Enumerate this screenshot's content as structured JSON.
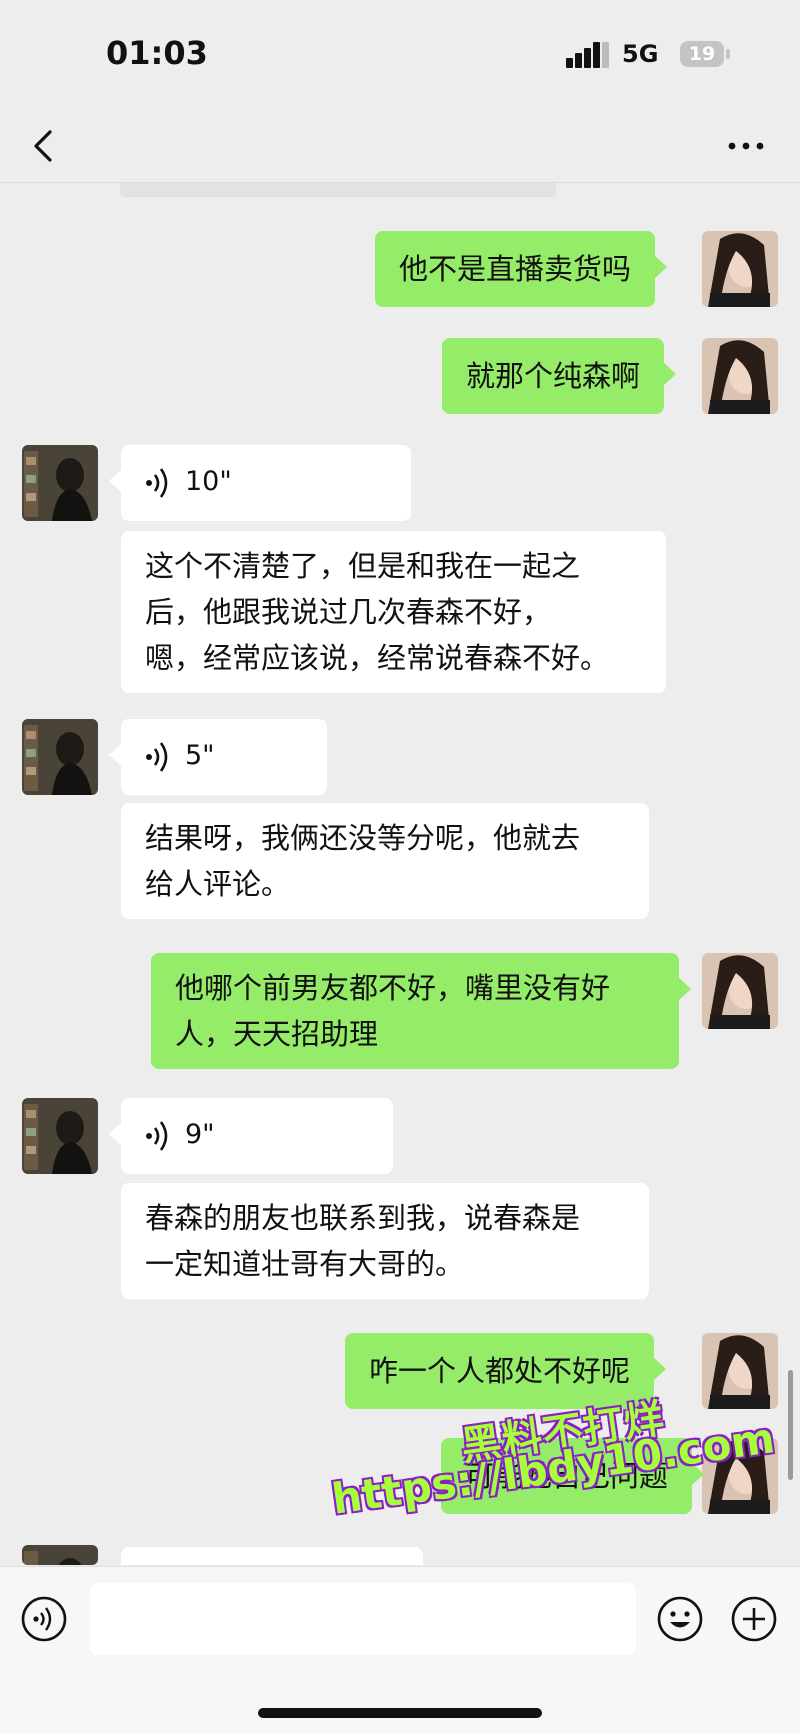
{
  "status_bar": {
    "time": "01:03",
    "network": "5G",
    "battery": "19"
  },
  "nav": {
    "back_icon": "chevron-left-icon",
    "more_icon": "more-dots-icon"
  },
  "messages": [
    {
      "side": "out",
      "type": "text",
      "text": "他不是直播卖货吗"
    },
    {
      "side": "out",
      "type": "text",
      "text": "就那个纯森啊"
    },
    {
      "side": "in",
      "type": "voice",
      "duration": "10\""
    },
    {
      "side": "in",
      "type": "text",
      "lines": [
        "这个不清楚了，但是和我在一起之",
        "后，他跟我说过几次春森不好，",
        "嗯，经常应该说，经常说春森不好。"
      ]
    },
    {
      "side": "in",
      "type": "voice",
      "duration": "5\""
    },
    {
      "side": "in",
      "type": "text",
      "lines": [
        "结果呀，我俩还没等分呢，他就去",
        "给人评论。"
      ]
    },
    {
      "side": "out",
      "type": "text",
      "lines": [
        "他哪个前男友都不好，嘴里没有好",
        "人，天天招助理"
      ]
    },
    {
      "side": "in",
      "type": "voice",
      "duration": "9\""
    },
    {
      "side": "in",
      "type": "text",
      "lines": [
        "春森的朋友也联系到我，说春森是",
        "一定知道壮哥有大哥的。"
      ]
    },
    {
      "side": "out",
      "type": "text",
      "text": "咋一个人都处不好呢"
    },
    {
      "side": "out",
      "type": "text",
      "text": "可能她自己问题"
    }
  ],
  "watermark": {
    "line1": "黑料不打烊",
    "line2": "https://lbdy10.com"
  },
  "input_bar": {
    "voice_icon": "voice-mode-icon",
    "emoji_icon": "emoji-icon",
    "plus_icon": "plus-icon"
  },
  "colors": {
    "background": "#ededed",
    "outgoing_bubble": "#95ec69",
    "incoming_bubble": "#ffffff"
  }
}
